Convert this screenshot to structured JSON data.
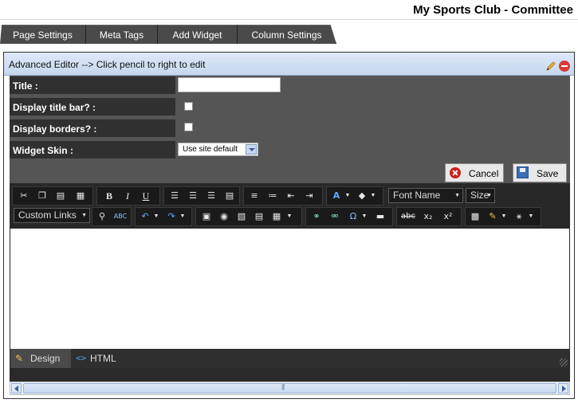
{
  "site": {
    "title": "My Sports Club - Committee"
  },
  "tabs": [
    {
      "label": "Page Settings"
    },
    {
      "label": "Meta Tags"
    },
    {
      "label": "Add Widget"
    },
    {
      "label": "Column Settings"
    }
  ],
  "panel": {
    "header_text": "Advanced Editor --> Click pencil to right to edit",
    "form": {
      "title_label": "Title :",
      "title_value": "",
      "display_title_bar_label": "Display title bar? :",
      "display_borders_label": "Display borders? :",
      "widget_skin_label": "Widget Skin :",
      "widget_skin_value": "Use site default"
    },
    "buttons": {
      "cancel": "Cancel",
      "save": "Save"
    }
  },
  "editor": {
    "toolbar": {
      "custom_links": "Custom Links",
      "font_name": "Font Name",
      "size": "Size",
      "row1_icons": [
        "cut-icon",
        "copy-icon",
        "paste-icon",
        "paste-plain-icon",
        "bold-icon",
        "italic-icon",
        "underline-icon",
        "align-left-icon",
        "align-center-icon",
        "align-right-icon",
        "justify-icon",
        "ordered-list-icon",
        "bullet-list-icon",
        "outdent-icon",
        "indent-icon",
        "font-color-icon",
        "highlight-icon"
      ],
      "row2_icons": [
        "find-icon",
        "spellcheck-icon",
        "undo-icon",
        "redo-icon",
        "image-icon",
        "flash-icon",
        "media-icon",
        "document-icon",
        "table-icon",
        "link-icon",
        "unlink-icon",
        "special-char-icon",
        "horizontal-rule-icon",
        "strikethrough-icon",
        "subscript-icon",
        "superscript-icon",
        "template-icon",
        "format-painter-icon",
        "module-icon"
      ],
      "bold": "B",
      "italic": "I",
      "underline": "U",
      "font_color": "A",
      "special_char": "Ω",
      "strike": "abc",
      "subscript": "x₂",
      "superscript": "x²"
    },
    "modes": {
      "design": "Design",
      "html": "HTML"
    }
  },
  "colors": {
    "toolbar_bg": "#282828",
    "form_bg": "#555555",
    "header_bg": "#c5d7ef",
    "tab_bg": "#4a4a4a"
  }
}
